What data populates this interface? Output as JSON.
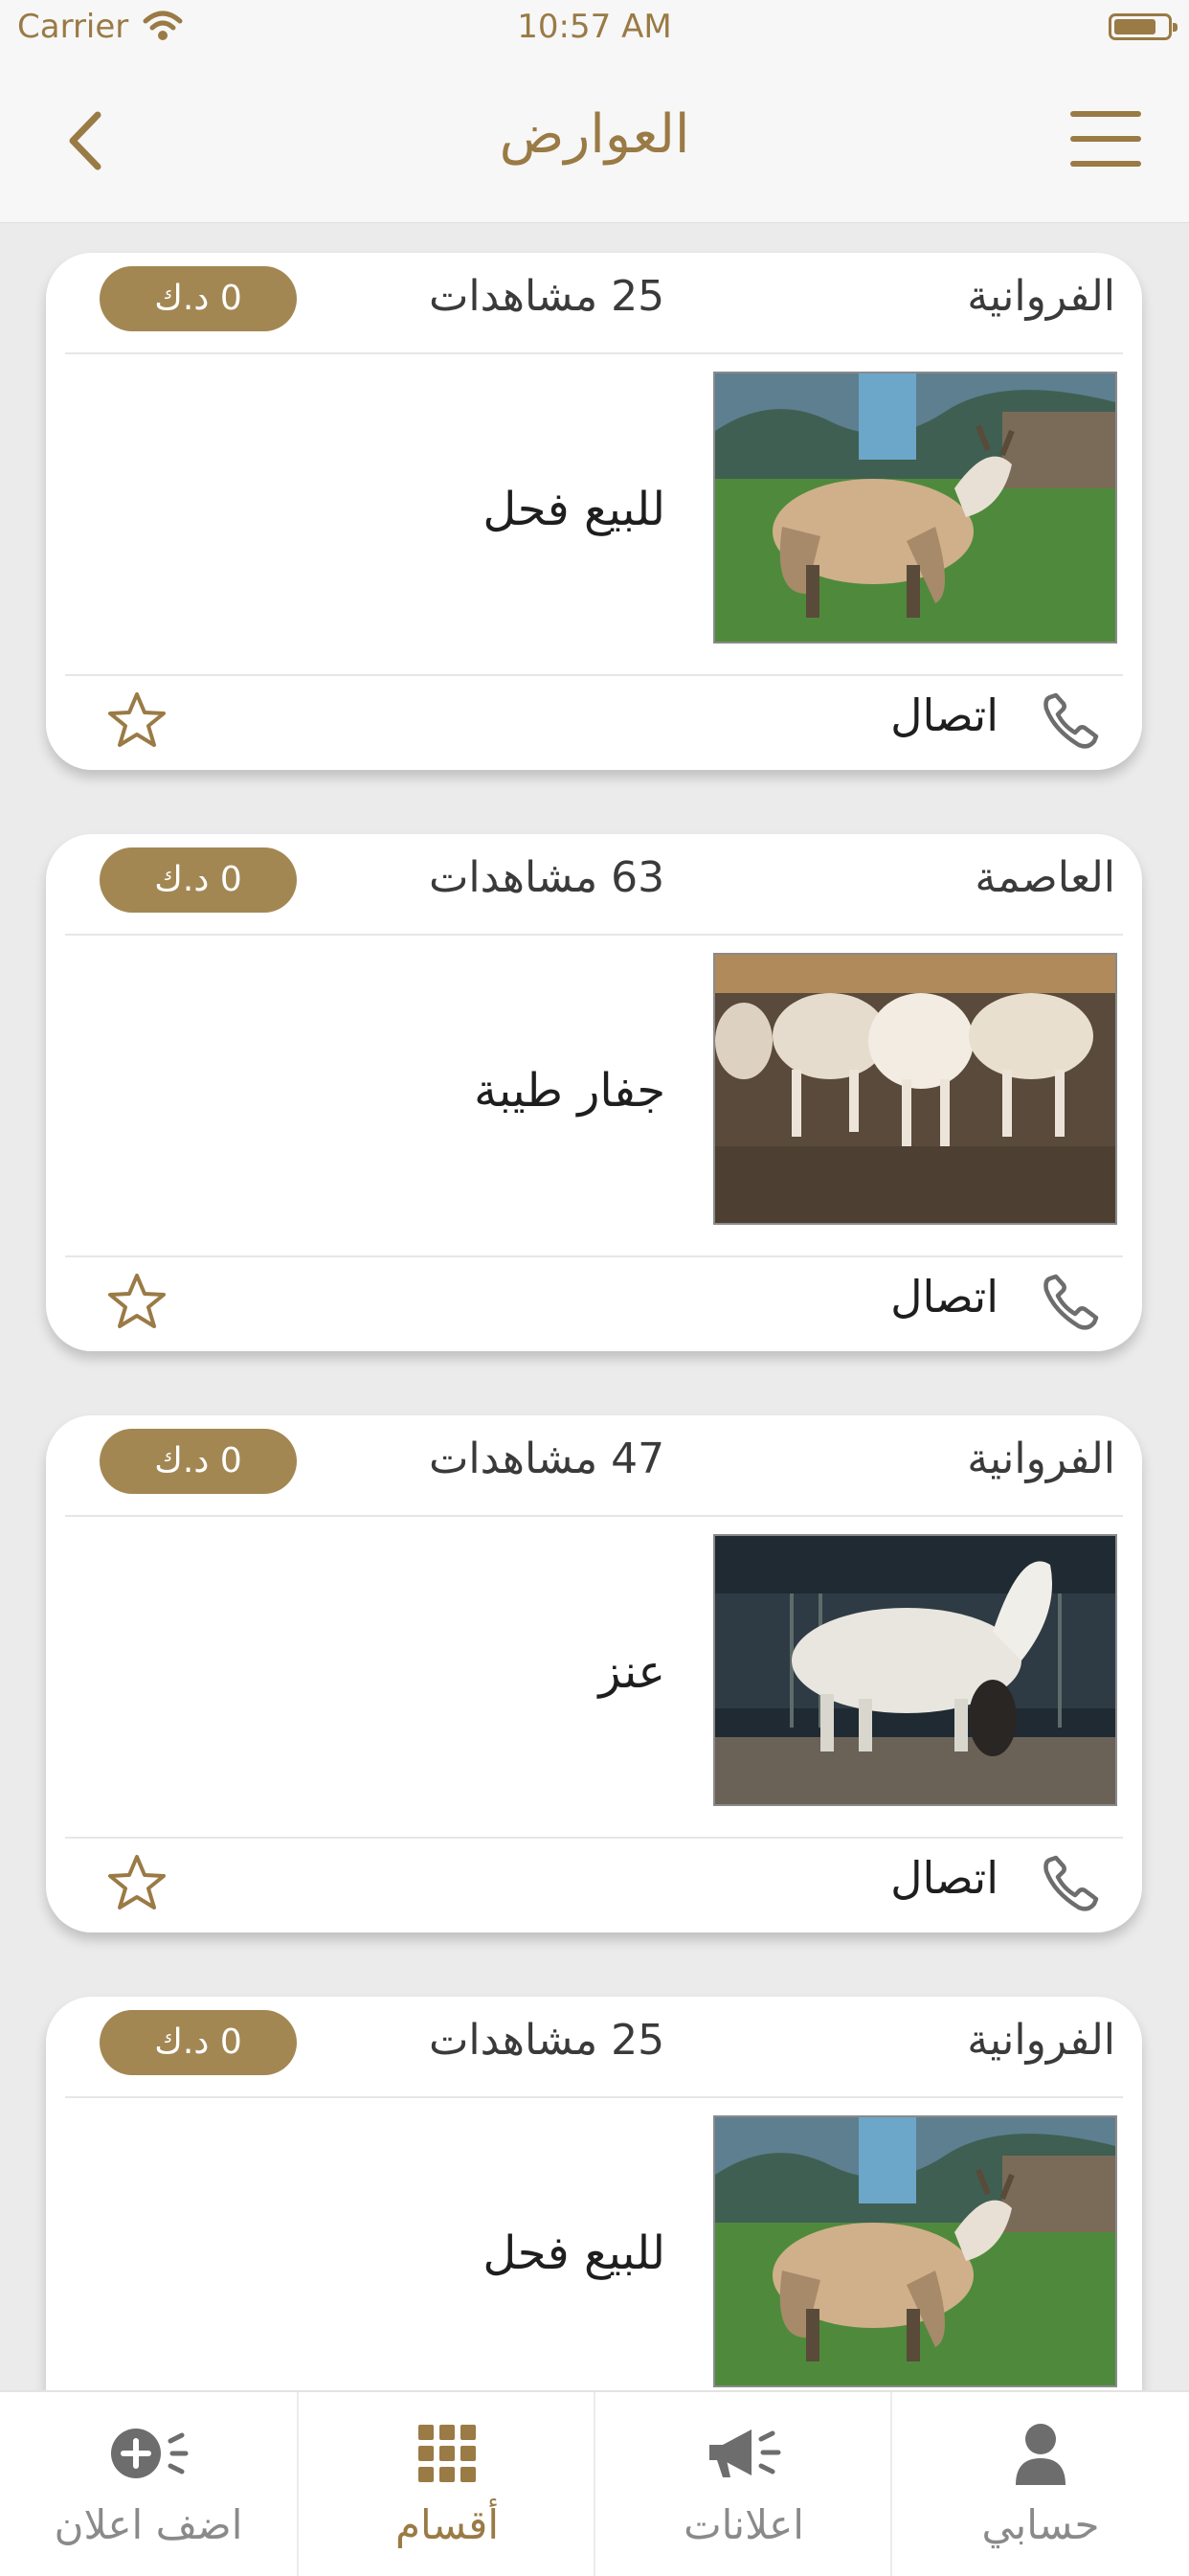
{
  "status_bar": {
    "carrier": "Carrier",
    "time": "10:57 AM",
    "battery_level": 0.8
  },
  "nav": {
    "title": "العوارض"
  },
  "theme": {
    "accent": "#9a7a45",
    "price_badge": "#a38753",
    "background": "#ebebeb"
  },
  "listings": [
    {
      "region": "الفروانية",
      "views": "25 مشاهدات",
      "price": "0 د.ك",
      "title": "للبيع فحل",
      "call_label": "اتصال",
      "photo": "goat-on-grass"
    },
    {
      "region": "العاصمة",
      "views": "63 مشاهدات",
      "price": "0 د.ك",
      "title": "جفار طيبة",
      "call_label": "اتصال",
      "photo": "goat-herd"
    },
    {
      "region": "الفروانية",
      "views": "47 مشاهدات",
      "price": "0 د.ك",
      "title": "عنز",
      "call_label": "اتصال",
      "photo": "white-goat-night"
    },
    {
      "region": "الفروانية",
      "views": "25 مشاهدات",
      "price": "0 د.ك",
      "title": "للبيع فحل",
      "call_label": "اتصال",
      "photo": "goat-on-grass"
    }
  ],
  "tabbar": [
    {
      "label": "اضف اعلان",
      "icon": "add-ad-icon",
      "active": false
    },
    {
      "label": "أقسام",
      "icon": "grid-icon",
      "active": true
    },
    {
      "label": "اعلانات",
      "icon": "megaphone-icon",
      "active": false
    },
    {
      "label": "حسابي",
      "icon": "user-icon",
      "active": false
    }
  ]
}
